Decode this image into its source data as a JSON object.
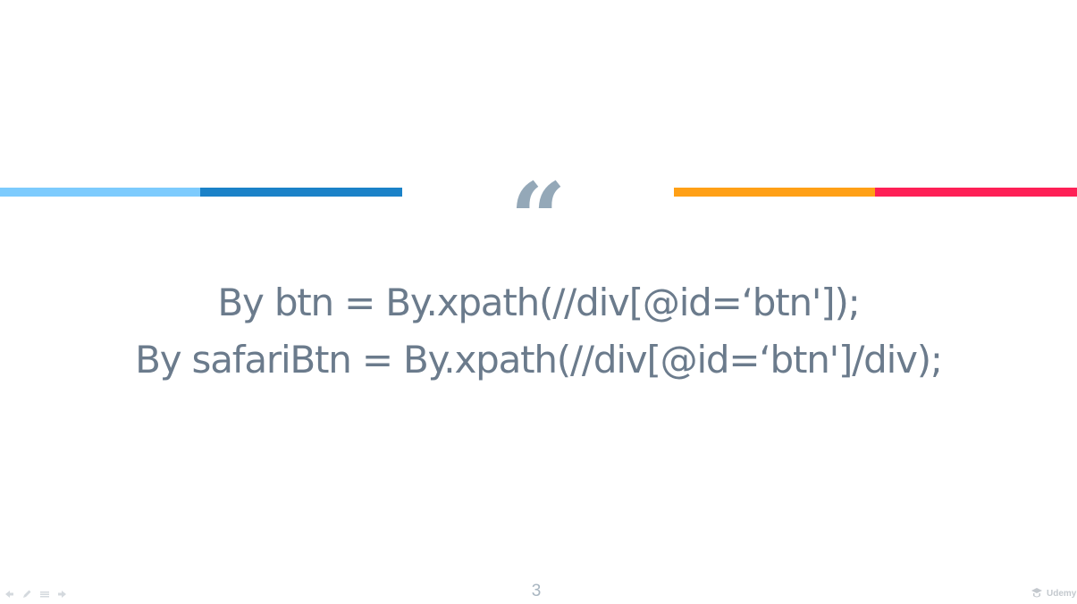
{
  "slide": {
    "quote_mark": "“",
    "lines": [
      "By btn = By.xpath(//div[@id=‘btn']);",
      "By safariBtn = By.xpath(//div[@id=‘btn']/div);"
    ],
    "page_number": "3"
  },
  "branding": {
    "name": "Udemy",
    "icon": "udemy-logo-icon"
  },
  "controls": {
    "icons": [
      "prev-arrow-icon",
      "pen-icon",
      "menu-icon",
      "next-arrow-icon"
    ]
  },
  "colors": {
    "bar_light_blue": "#7dcbfd",
    "bar_blue": "#1b82c8",
    "bar_orange": "#ffa016",
    "bar_red": "#fe2056",
    "quote_mark": "#94a8b8",
    "text": "#6b7b8c",
    "page_number": "#a8b5c0",
    "control_icon": "#d4d9de",
    "brand": "#c4c9ce"
  }
}
